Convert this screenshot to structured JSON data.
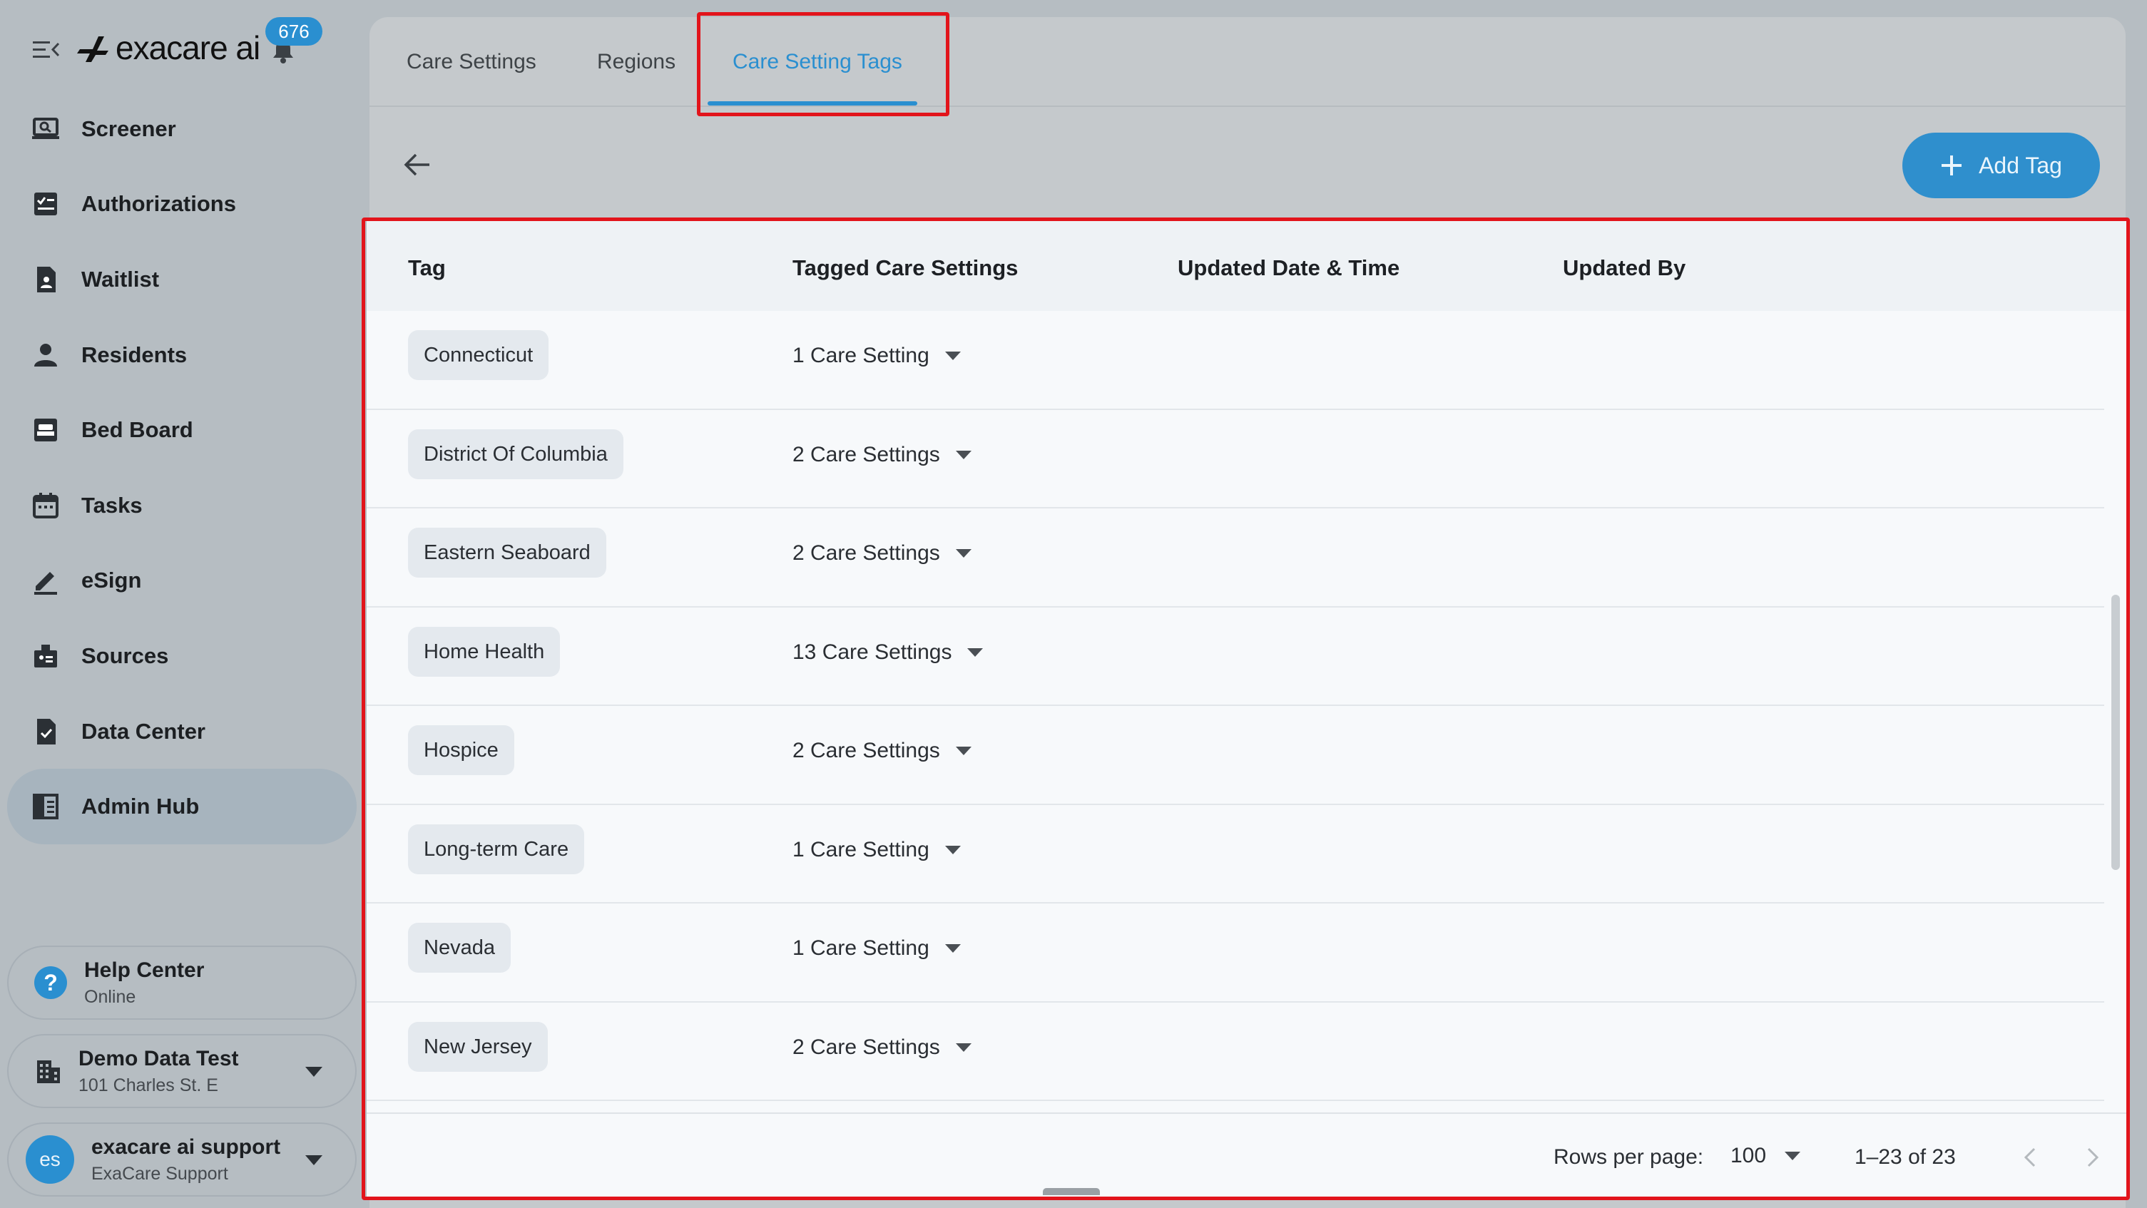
{
  "brand": {
    "name": "exacare ai",
    "notification_count": "676"
  },
  "sidebar": {
    "items": [
      {
        "label": "Screener",
        "icon": "screener-icon"
      },
      {
        "label": "Authorizations",
        "icon": "authorizations-icon"
      },
      {
        "label": "Waitlist",
        "icon": "waitlist-icon"
      },
      {
        "label": "Residents",
        "icon": "residents-icon"
      },
      {
        "label": "Bed Board",
        "icon": "bed-board-icon"
      },
      {
        "label": "Tasks",
        "icon": "calendar-icon"
      },
      {
        "label": "eSign",
        "icon": "pen-icon"
      },
      {
        "label": "Sources",
        "icon": "sources-icon"
      },
      {
        "label": "Data Center",
        "icon": "data-center-icon"
      },
      {
        "label": "Admin Hub",
        "icon": "admin-hub-icon",
        "active": true
      }
    ],
    "help": {
      "title": "Help Center",
      "status": "Online"
    },
    "facility": {
      "name": "Demo Data Test",
      "address": "101 Charles St. E"
    },
    "user": {
      "initials": "es",
      "name": "exacare ai support",
      "org": "ExaCare Support"
    }
  },
  "tabs": [
    {
      "label": "Care Settings"
    },
    {
      "label": "Regions"
    },
    {
      "label": "Care Setting Tags",
      "active": true
    }
  ],
  "toolbar": {
    "add_label": "Add Tag"
  },
  "table": {
    "headers": [
      "Tag",
      "Tagged Care Settings",
      "Updated Date & Time",
      "Updated By"
    ],
    "rows": [
      {
        "tag": "Connecticut",
        "care_settings": "1 Care Setting"
      },
      {
        "tag": "District Of Columbia",
        "care_settings": "2 Care Settings"
      },
      {
        "tag": "Eastern Seaboard",
        "care_settings": "2 Care Settings"
      },
      {
        "tag": "Home Health",
        "care_settings": "13 Care Settings"
      },
      {
        "tag": "Hospice",
        "care_settings": "2 Care Settings"
      },
      {
        "tag": "Long-term Care",
        "care_settings": "1 Care Setting"
      },
      {
        "tag": "Nevada",
        "care_settings": "1 Care Setting"
      },
      {
        "tag": "New Jersey",
        "care_settings": "2 Care Settings"
      }
    ]
  },
  "pagination": {
    "rows_per_page_label": "Rows per page:",
    "rows_per_page": "100",
    "range": "1–23 of 23"
  },
  "colors": {
    "accent": "#2a8fd0",
    "highlight": "#e2141b"
  }
}
